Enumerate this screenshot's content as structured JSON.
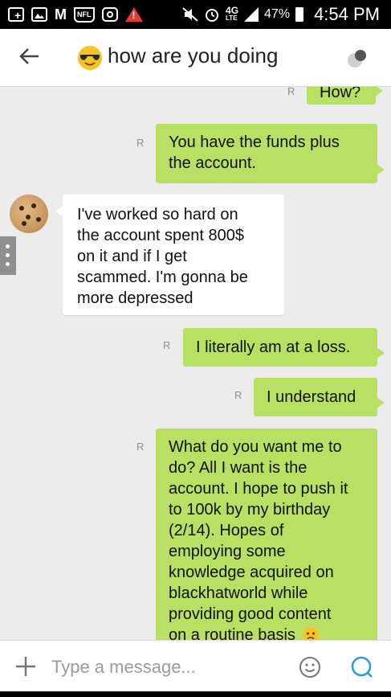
{
  "status_bar": {
    "network": "4G",
    "network_sub": "LTE",
    "battery": "47%",
    "time": "4:54 PM",
    "nfl": "NFL",
    "alert": "!"
  },
  "header": {
    "title": "how are you doing",
    "emoji_icon": "sunglasses-emoji-icon"
  },
  "read_receipt": "R",
  "messages": [
    {
      "from": "me",
      "text": "How?"
    },
    {
      "from": "me",
      "text": "You have the funds plus the account."
    },
    {
      "from": "contact",
      "lines": [
        "I've worked so hard on",
        "the account spent 800$",
        "on it and if I get",
        "scammed. I'm gonna be",
        "more depressed"
      ]
    },
    {
      "from": "me",
      "text": "I literally am at a loss."
    },
    {
      "from": "me",
      "text": "I understand"
    },
    {
      "from": "me",
      "lines": [
        "What do you want me to",
        "do? All I want is the",
        "account. I hope to push it",
        "to 100k by my birthday",
        "(2/14). Hopes of",
        "employing some",
        "knowledge acquired on",
        "blackhatworld while",
        "providing good content",
        "on a routine basis"
      ]
    }
  ],
  "input": {
    "placeholder": "Type a message..."
  },
  "colors": {
    "outgoing": "#b8e062",
    "incoming": "#ffffff",
    "background": "#ececec"
  }
}
